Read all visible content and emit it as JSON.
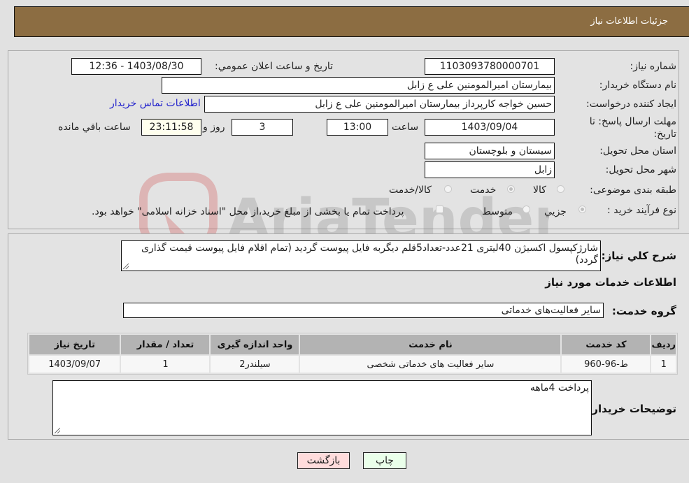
{
  "header": {
    "title": "جزئیات اطلاعات نیاز"
  },
  "form": {
    "need_number": {
      "label": "شماره نیاز:",
      "value": "1103093780000701"
    },
    "announce": {
      "label": "تاریخ و ساعت اعلان عمومي:",
      "value": "1403/08/30 - 12:36"
    },
    "buyer_org": {
      "label": "نام دستگاه خریدار:",
      "value": "بیمارستان امیرالمومنین علی  ع  زابل"
    },
    "creator": {
      "label": "ایجاد کننده درخواست:",
      "value": "حسین خواجه کارپرداز بیمارستان امیرالمومنین علی  ع  زابل"
    },
    "contact_link": "اطلاعات تماس خریدار",
    "deadline": {
      "label": "مهلت ارسال پاسخ: تا تاریخ:",
      "date": "1403/09/04",
      "time_label": "ساعت",
      "time": "13:00",
      "days": "3",
      "days_label": "روز و",
      "remaining": "23:11:58",
      "remaining_label": "ساعت باقي مانده"
    },
    "province": {
      "label": "استان محل تحویل:",
      "value": "سیستان و بلوچستان"
    },
    "city": {
      "label": "شهر محل تحویل:",
      "value": "زابل"
    },
    "category": {
      "label": "طبقه بندی موضوعی:",
      "options": [
        "کالا",
        "خدمت",
        "کالا/خدمت"
      ],
      "selected": "خدمت"
    },
    "process": {
      "label": "نوع فرآیند خرید :",
      "options": [
        "جزيي",
        "متوسط"
      ],
      "selected": "جزيي",
      "treasury_note": "پرداخت تمام یا بخشی از مبلغ خرید،از محل \"اسناد خزانه اسلامی\" خواهد بود."
    }
  },
  "details": {
    "description_label": "شرح کلي نیاز:",
    "description": "شارژکپسول اکسیژن 40لیتری 21عدد-تعداد5قلم دیگربه فایل پیوست گردید (تمام اقلام فایل پیوست قیمت گذاری گردد)",
    "services_heading": "اطلاعات خدمات مورد نیاز",
    "service_group_label": "گروه خدمت:",
    "service_group": "سایر فعالیت‌های خدماتی",
    "table": {
      "headers": [
        "ردیف",
        "کد خدمت",
        "نام خدمت",
        "واحد اندازه گیری",
        "تعداد / مقدار",
        "تاریخ نیاز"
      ],
      "rows": [
        [
          "1",
          "ط-96-960",
          "سایر فعالیت های خدماتی شخصی",
          "سیلندر2",
          "1",
          "1403/09/07"
        ]
      ]
    },
    "buyer_notes_label": "توضیحات خریدار:",
    "buyer_notes": "پرداخت 4ماهه"
  },
  "buttons": {
    "print": "چاپ",
    "back": "بازگشت"
  },
  "colors": {
    "header_bg": "#8c6d42",
    "print_bg": "#eaffea",
    "back_bg": "#ffdcdc",
    "link": "#2222cc"
  },
  "watermark": "AriaTender.neT"
}
